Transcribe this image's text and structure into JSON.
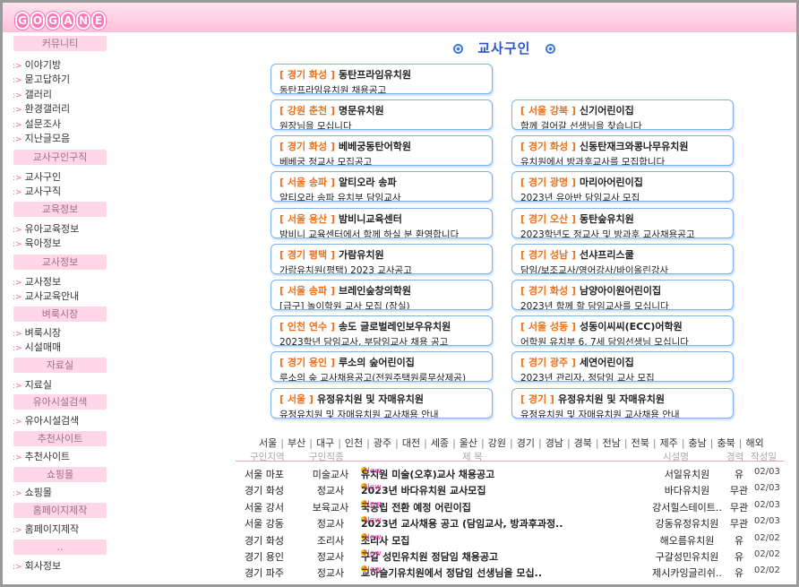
{
  "logo": "GOGANE",
  "sidebar": {
    "sections": [
      {
        "header": "커뮤니티",
        "items": [
          "이야기방",
          "묻고답하기",
          "갤러리",
          "환경갤러리",
          "설문조사",
          "지난글모음"
        ]
      },
      {
        "header": "교사구인구직",
        "items": [
          "교사구인",
          "교사구직"
        ]
      },
      {
        "header": "교육정보",
        "items": [
          "유아교육정보",
          "육아정보"
        ]
      },
      {
        "header": "교사정보",
        "items": [
          "교사정보",
          "교사교육안내"
        ]
      },
      {
        "header": "벼룩시장",
        "items": [
          "벼룩시장",
          "시설매매"
        ]
      },
      {
        "header": "자료실",
        "items": [
          "지료실"
        ]
      },
      {
        "header": "유아시설검색",
        "items": [
          "유아시설검색"
        ]
      },
      {
        "header": "추천사이트",
        "items": [
          "추천사이트"
        ]
      },
      {
        "header": "쇼핑몰",
        "items": [
          "쇼핑몰"
        ]
      },
      {
        "header": "홈페이지제작",
        "items": [
          "홈페이지제작"
        ]
      },
      {
        "header": "..",
        "items": [
          "회사정보"
        ]
      }
    ]
  },
  "page_title": "교사구인",
  "featured_cards": [
    {
      "region": "[ 경기 화성 ]",
      "name": "동탄프라임유치원",
      "desc": "동탄프라임유치원 채용공고"
    },
    {
      "region": "[ 강원 춘천 ]",
      "name": "명문유치원",
      "desc": "원장님을 모십니다"
    },
    {
      "region": "[ 서울 강북 ]",
      "name": "신기어린이집",
      "desc": "함께 걸어갈 선생님을 찾습니다"
    },
    {
      "region": "[ 경기 화성 ]",
      "name": "베베궁동탄어학원",
      "desc": "베베궁 정교사 모집공고"
    },
    {
      "region": "[ 경기 화성 ]",
      "name": "신동탄재크와콩나무유치원",
      "desc": "유치원에서 방과후교사를 모집합니다"
    },
    {
      "region": "[ 서울 송파 ]",
      "name": "알티오라 송파",
      "desc": "알티오라 송파 유치부 담임교사"
    },
    {
      "region": "[ 경기 광명 ]",
      "name": "마리아어린이집",
      "desc": "2023년 유아반 담임교사 모집"
    },
    {
      "region": "[ 서울 용산 ]",
      "name": "밤비니교육센터",
      "desc": "밤비니 교육센터에서 함께 하실 분 환영합니다"
    },
    {
      "region": "[ 경기 오산 ]",
      "name": "동탄숲유치원",
      "desc": "2023학년도 정교사 및 방과후 교사채용공고"
    },
    {
      "region": "[ 경기 평택 ]",
      "name": "가람유치원",
      "desc": "가람유치원(평택) 2023 교사공고"
    },
    {
      "region": "[ 경기 성남 ]",
      "name": "선샤프리스쿨",
      "desc": "담임/보조교사/영어강사/바이올린강사"
    },
    {
      "region": "[ 서울 송파 ]",
      "name": "브레인숲창의학원",
      "desc": "[급구] 놀이학원 교사 모집 (잠실)"
    },
    {
      "region": "[ 경기 화성 ]",
      "name": "남양아이원어린이집",
      "desc": "2023년 함께 할 담임교사를 모십니다"
    },
    {
      "region": "[ 인천 연수 ]",
      "name": "송도 글로벌레인보우유치원",
      "desc": "2023학년 담임교사, 부담임교사 채용 공고"
    },
    {
      "region": "[ 서울 성동 ]",
      "name": "성동이씨씨(ECC)어학원",
      "desc": "어학원 유치부 6, 7세 담임선생님 모십니다"
    },
    {
      "region": "[ 경기 용인 ]",
      "name": "루소의 숲어린이집",
      "desc": "루소의 숲 교사채용공고(전원주택원룸무상제공)"
    },
    {
      "region": "[ 경기 광주 ]",
      "name": "세연어린이집",
      "desc": "2023년 관리자, 정담임 교사 모집"
    },
    {
      "region": "[ 서울 ]",
      "name": "유정유치원 및 자매유치원",
      "desc": "유정유치원 및 자매유치원 교사채용 안내"
    },
    {
      "region": "[ 경기 ]",
      "name": "유정유치원 및 자매유치원",
      "desc": "유정유치원 및 자매유치원 교사채용 안내"
    }
  ],
  "region_filters": [
    "서울",
    "부산",
    "대구",
    "인천",
    "광주",
    "대전",
    "세종",
    "울산",
    "강원",
    "경기",
    "경남",
    "경북",
    "전남",
    "전북",
    "제주",
    "충남",
    "충북",
    "해외"
  ],
  "table": {
    "headers": {
      "region": "구인지역",
      "job": "구인직종",
      "title": "제 목",
      "org": "시설명",
      "exp": "경력",
      "date": "작성일"
    },
    "rows": [
      {
        "region": "서울 마포",
        "job": "미술교사",
        "title": "유치원 미술(오후)교사 채용공고",
        "org": "서일유치원",
        "exp": "유",
        "date": "02/03"
      },
      {
        "region": "경기 화성",
        "job": "정교사",
        "title": "2023년 바다유치원 교사모집",
        "org": "바다유치원",
        "exp": "무관",
        "date": "02/03"
      },
      {
        "region": "서울 강서",
        "job": "보육교사",
        "title": "국공립 전환 예정 어린이집",
        "org": "강서힐스테이트..",
        "exp": "무관",
        "date": "02/03"
      },
      {
        "region": "서울 강동",
        "job": "정교사",
        "title": "2023년 교사채용 공고 (담임교사, 방과후과정..",
        "org": "강동유정유치원",
        "exp": "무관",
        "date": "02/03"
      },
      {
        "region": "경기 화성",
        "job": "조리사",
        "title": "조리사 모집",
        "org": "해오름유치원",
        "exp": "유",
        "date": "02/02"
      },
      {
        "region": "경기 용인",
        "job": "정교사",
        "title": "구갈 성민유치원 정담임 채용공고",
        "org": "구갈성민유치원",
        "exp": "유",
        "date": "02/02"
      },
      {
        "region": "경기 파주",
        "job": "정교사",
        "title": "교하슬기유치원에서 정담임 선생님을 모십..",
        "org": "제시카잉글리쉬..",
        "exp": "유",
        "date": "02/02"
      }
    ],
    "new_label": "New"
  },
  "colors": {
    "accent_pink": "#ffc0da",
    "card_border": "#7fb1ea",
    "region_orange": "#f07018",
    "title_blue": "#2a56c8"
  }
}
